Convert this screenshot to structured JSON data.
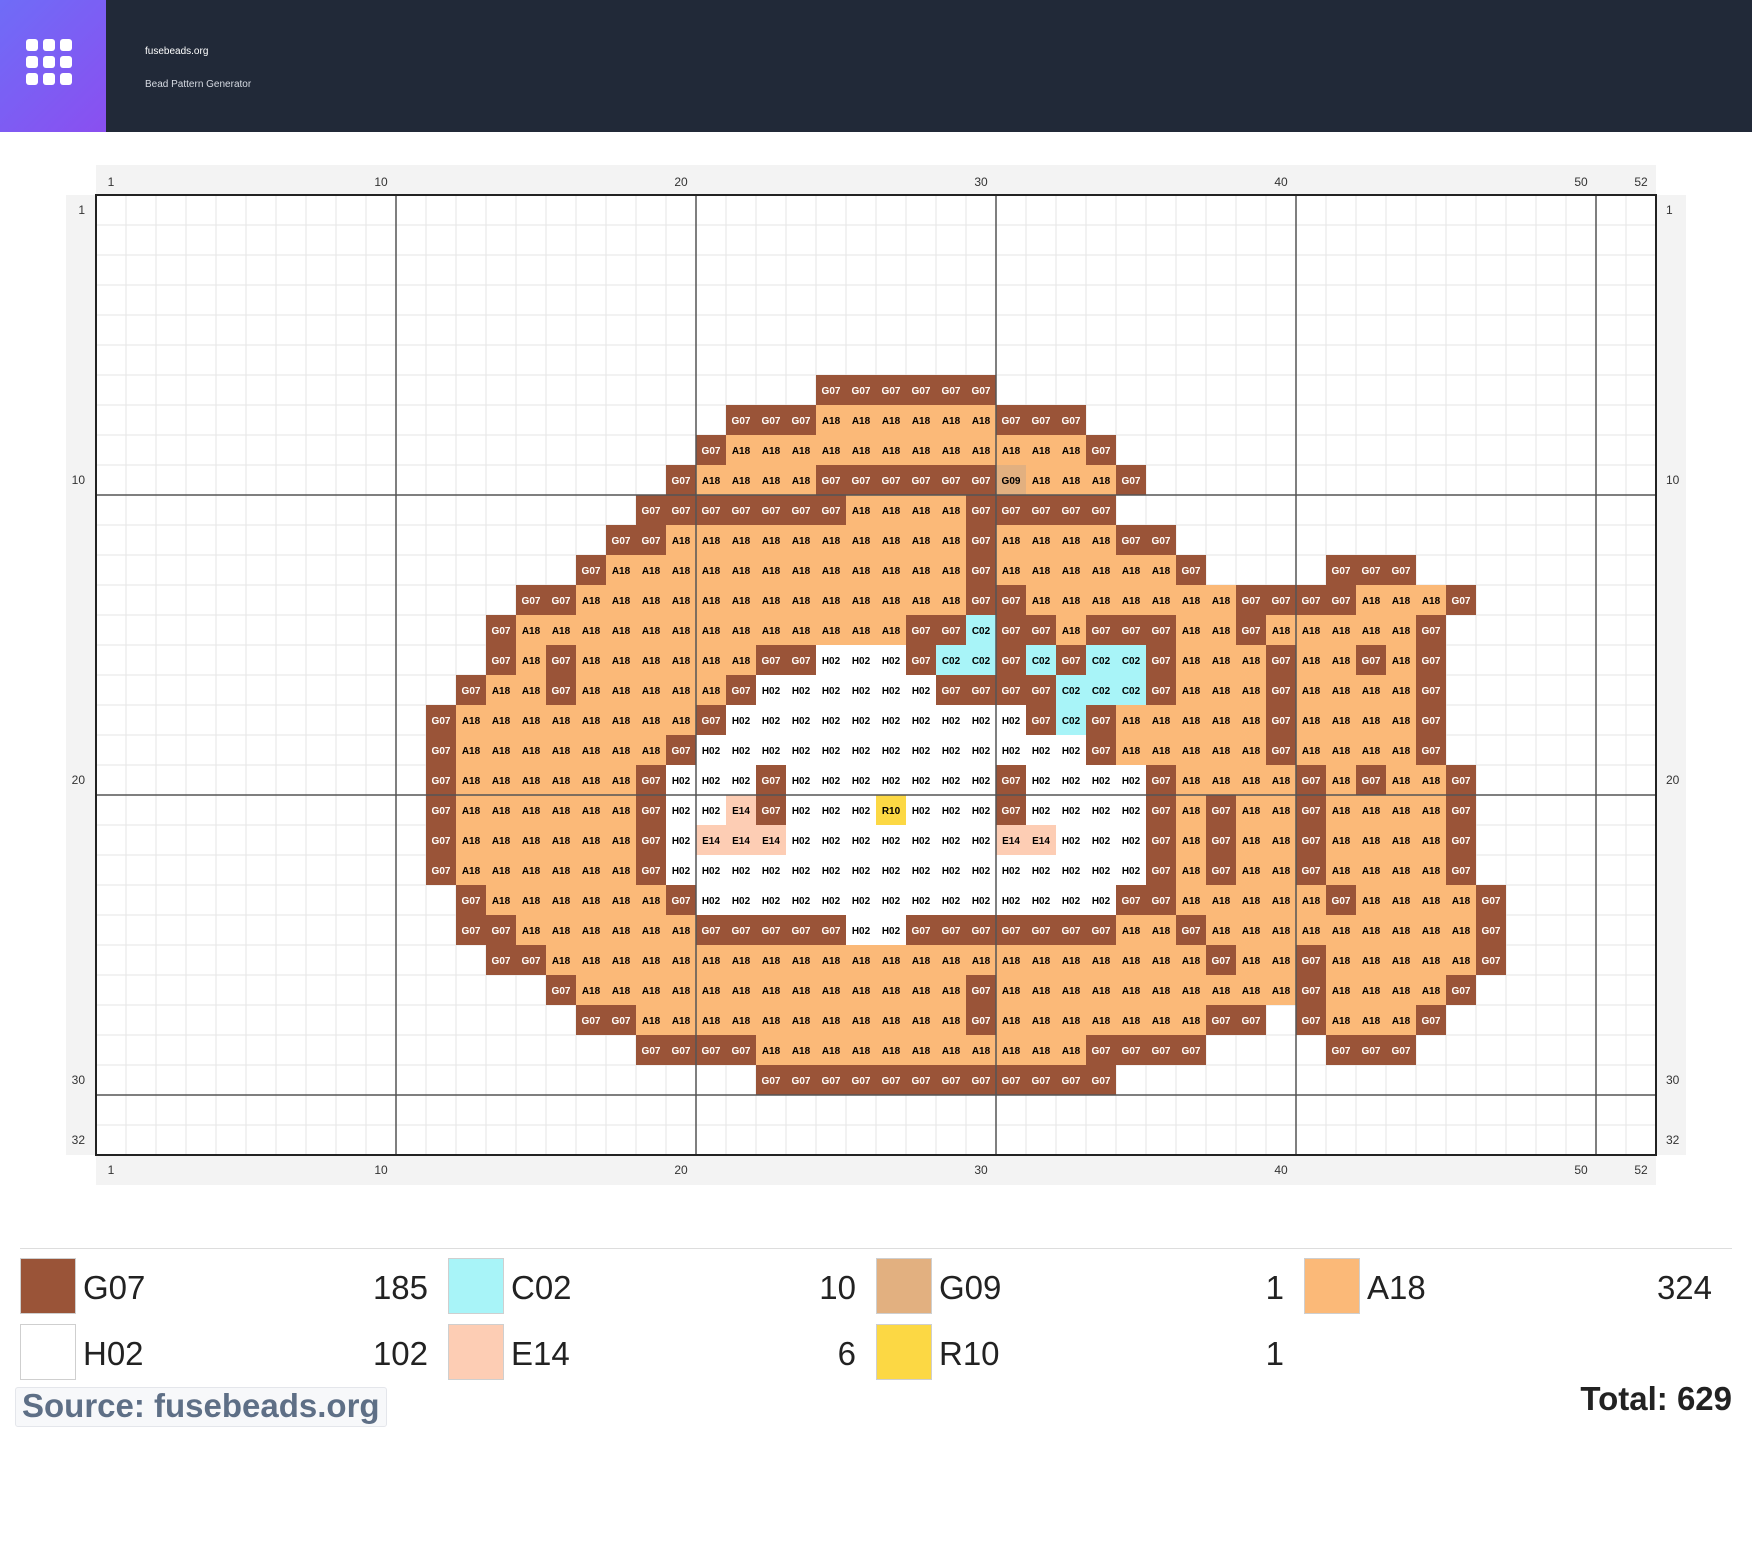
{
  "header": {
    "site_name": "fusebeads.org",
    "tagline": "Bead Pattern Generator",
    "logo_icon": "grid-apps-icon",
    "colors": {
      "bar": "#212938",
      "logo_from": "#6f6cf7",
      "logo_to": "#8a4ff0"
    }
  },
  "pattern": {
    "width": 52,
    "height": 32,
    "x_ticks": [
      1,
      10,
      20,
      30,
      40,
      50,
      52
    ],
    "y_ticks": [
      1,
      10,
      20,
      30,
      32
    ],
    "palette": {
      "G07": {
        "color": "#9a5438",
        "label_color": "#ffffff"
      },
      "A18": {
        "color": "#fbb978",
        "label_color": "#000000"
      },
      "H02": {
        "color": "#ffffff",
        "label_color": "#000000"
      },
      "C02": {
        "color": "#a8f4f8",
        "label_color": "#000000"
      },
      "G09": {
        "color": "#e2b080",
        "label_color": "#000000"
      },
      "E14": {
        "color": "#fdcdb4",
        "label_color": "#000000"
      },
      "R10": {
        "color": "#fcd844",
        "label_color": "#000000"
      }
    },
    "rows": [
      {
        "y": 7,
        "cells": [
          [
            25,
            "G07,G07,G07,G07,G07,G07"
          ]
        ]
      },
      {
        "y": 8,
        "cells": [
          [
            22,
            "G07,G07,G07,A18,A18,A18,A18,A18,A18,G07,G07,G07"
          ]
        ]
      },
      {
        "y": 9,
        "cells": [
          [
            21,
            "G07,A18,A18,A18,A18,A18,A18,A18,A18,A18,A18,A18,A18,G07"
          ]
        ]
      },
      {
        "y": 10,
        "cells": [
          [
            20,
            "G07,A18,A18,A18,A18,G07,G07,G07,G07,G07,G07,G09,A18,A18,A18,G07"
          ]
        ]
      },
      {
        "y": 11,
        "cells": [
          [
            19,
            "G07,G07,G07,G07,G07,G07,G07,A18,A18,A18,A18,G07,G07,G07,G07,G07"
          ]
        ]
      },
      {
        "y": 12,
        "cells": [
          [
            18,
            "G07,G07,A18,A18,A18,A18,A18,A18,A18,A18,A18,A18,G07,A18,A18,A18,A18,G07,G07"
          ]
        ]
      },
      {
        "y": 13,
        "cells": [
          [
            17,
            "G07,A18,A18,A18,A18,A18,A18,A18,A18,A18,A18,A18,A18,G07,A18,A18,A18,A18,A18,A18,G07"
          ],
          [
            42,
            "G07,G07,G07"
          ]
        ]
      },
      {
        "y": 14,
        "cells": [
          [
            15,
            "G07,G07,A18,A18,A18,A18,A18,A18,A18,A18,A18,A18,A18,A18,A18,G07,G07,A18,A18,A18,A18,A18,A18,A18,G07,G07,G07,G07,A18,A18,A18,G07"
          ]
        ]
      },
      {
        "y": 15,
        "cells": [
          [
            14,
            "G07,A18,A18,A18,A18,A18,A18,A18,A18,A18,A18,A18,A18,A18,G07,G07,C02,G07,G07,A18,G07,G07,G07,A18,A18,G07,A18,A18,A18,A18,A18,G07"
          ]
        ]
      },
      {
        "y": 16,
        "cells": [
          [
            14,
            "G07,A18,G07,A18,A18,A18,A18,A18,A18,G07,G07,H02,H02,H02,G07,C02,C02,G07,C02,G07,C02,C02,G07,A18,A18,A18,G07,A18,A18,G07,A18,G07"
          ]
        ]
      },
      {
        "y": 17,
        "cells": [
          [
            13,
            "G07,A18,A18,G07,A18,A18,A18,A18,A18,G07,H02,H02,H02,H02,H02,H02,G07,G07,G07,G07,C02,C02,C02,G07,A18,A18,A18,G07,A18,A18,A18,A18,G07"
          ]
        ]
      },
      {
        "y": 18,
        "cells": [
          [
            12,
            "G07,A18,A18,A18,A18,A18,A18,A18,A18,G07,H02,H02,H02,H02,H02,H02,H02,H02,H02,H02,G07,C02,G07,A18,A18,A18,A18,A18,G07,A18,A18,A18,A18,G07"
          ]
        ]
      },
      {
        "y": 19,
        "cells": [
          [
            12,
            "G07,A18,A18,A18,A18,A18,A18,A18,G07,H02,H02,H02,H02,H02,H02,H02,H02,H02,H02,H02,H02,H02,G07,A18,A18,A18,A18,A18,G07,A18,A18,A18,A18,G07"
          ]
        ]
      },
      {
        "y": 20,
        "cells": [
          [
            12,
            "G07,A18,A18,A18,A18,A18,A18,G07,H02,H02,H02,G07,H02,H02,H02,H02,H02,H02,H02,G07,H02,H02,H02,H02,G07,A18,A18,A18,A18,G07,A18,G07,A18,A18,G07"
          ]
        ]
      },
      {
        "y": 21,
        "cells": [
          [
            12,
            "G07,A18,A18,A18,A18,A18,A18,G07,H02,H02,E14,G07,H02,H02,H02,R10,H02,H02,H02,G07,H02,H02,H02,H02,G07,A18,G07,A18,A18,G07,A18,A18,A18,A18,G07"
          ]
        ]
      },
      {
        "y": 22,
        "cells": [
          [
            12,
            "G07,A18,A18,A18,A18,A18,A18,G07,H02,E14,E14,E14,H02,H02,H02,H02,H02,H02,H02,E14,E14,H02,H02,H02,G07,A18,G07,A18,A18,G07,A18,A18,A18,A18,G07"
          ]
        ]
      },
      {
        "y": 23,
        "cells": [
          [
            12,
            "G07,A18,A18,A18,A18,A18,A18,G07,H02,H02,H02,H02,H02,H02,H02,H02,H02,H02,H02,H02,H02,H02,H02,H02,G07,A18,G07,A18,A18,G07,A18,A18,A18,A18,G07"
          ]
        ]
      },
      {
        "y": 24,
        "cells": [
          [
            13,
            "G07,A18,A18,A18,A18,A18,A18,G07,H02,H02,H02,H02,H02,H02,H02,H02,H02,H02,H02,H02,H02,H02,G07,G07,A18,A18,A18,A18,A18,G07,A18,A18,A18,A18,G07"
          ]
        ]
      },
      {
        "y": 25,
        "cells": [
          [
            13,
            "G07,G07,A18,A18,A18,A18,A18,A18,G07,G07,G07,G07,G07,H02,H02,G07,G07,G07,G07,G07,G07,G07,A18,A18,G07,A18,A18,A18,A18,A18,A18,A18,A18,A18,G07"
          ]
        ]
      },
      {
        "y": 26,
        "cells": [
          [
            14,
            "G07,G07,A18,A18,A18,A18,A18,A18,A18,A18,A18,A18,A18,A18,A18,A18,A18,A18,A18,A18,A18,A18,A18,A18,G07,A18,A18,G07,A18,A18,A18,A18,A18,G07"
          ]
        ]
      },
      {
        "y": 27,
        "cells": [
          [
            16,
            "G07,A18,A18,A18,A18,A18,A18,A18,A18,A18,A18,A18,A18,A18,G07,A18,A18,A18,A18,A18,A18,A18,A18,A18,A18,G07,A18,A18,A18,A18,G07"
          ]
        ]
      },
      {
        "y": 28,
        "cells": [
          [
            17,
            "G07,G07,A18,A18,A18,A18,A18,A18,A18,A18,A18,A18,A18,G07,A18,A18,A18,A18,A18,A18,A18,G07,G07"
          ],
          [
            41,
            "G07,A18,A18,A18,G07"
          ]
        ]
      },
      {
        "y": 29,
        "cells": [
          [
            19,
            "G07,G07,G07,G07,A18,A18,A18,A18,A18,A18,A18,A18,A18,A18,A18,G07,G07,G07,G07"
          ],
          [
            42,
            "G07,G07,G07"
          ]
        ]
      },
      {
        "y": 30,
        "cells": [
          [
            23,
            "G07,G07,G07,G07,G07,G07,G07,G07,G07,G07,G07,G07"
          ]
        ]
      }
    ]
  },
  "legend": {
    "items": [
      {
        "code": "G07",
        "count": "185",
        "color": "#9a5438"
      },
      {
        "code": "C02",
        "count": "10",
        "color": "#a8f4f8"
      },
      {
        "code": "G09",
        "count": "1",
        "color": "#e2b080"
      },
      {
        "code": "A18",
        "count": "324",
        "color": "#fbb978"
      },
      {
        "code": "H02",
        "count": "102",
        "color": "#ffffff"
      },
      {
        "code": "E14",
        "count": "6",
        "color": "#fdcdb4"
      },
      {
        "code": "R10",
        "count": "1",
        "color": "#fcd844"
      }
    ],
    "source": "Source: fusebeads.org",
    "total": "Total: 629"
  }
}
